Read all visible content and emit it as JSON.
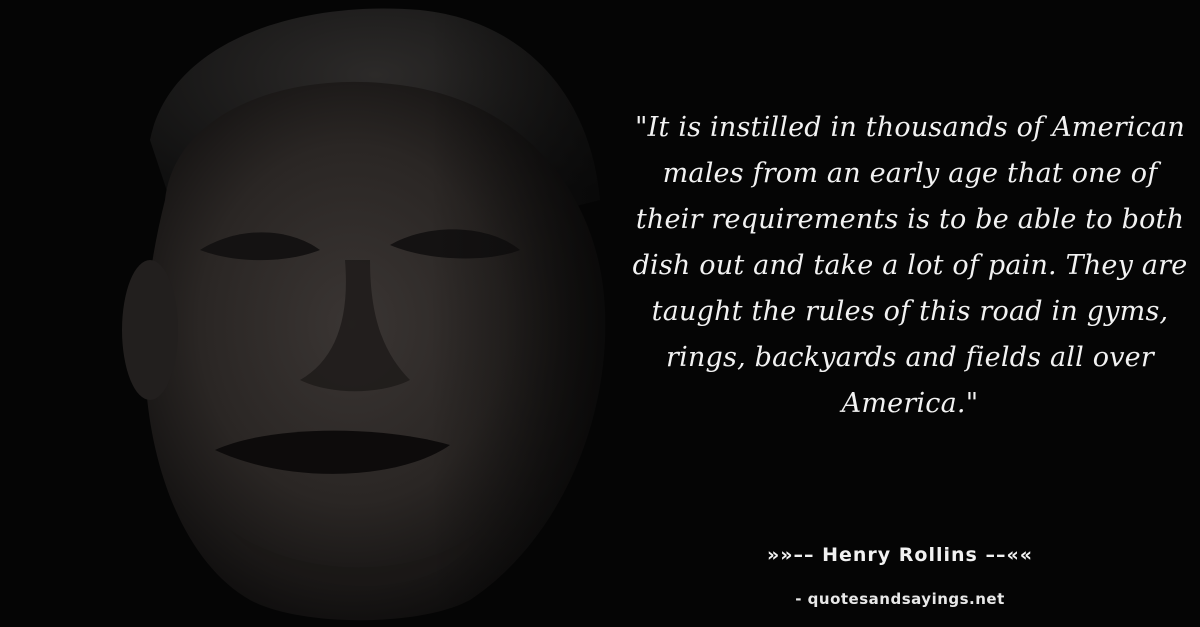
{
  "quote": {
    "text": "\"It is instilled in thousands of American males from an early age that one of their requirements is to be able to both dish out and take a lot of pain. They are taught the rules of this road in gyms, rings, backyards and fields all over America.\""
  },
  "author": {
    "line": "»»–– Henry Rollins ––««"
  },
  "site": {
    "credit": "- quotesandsayings.net"
  },
  "colors": {
    "background": "#050505",
    "text": "#f2f2f2"
  }
}
